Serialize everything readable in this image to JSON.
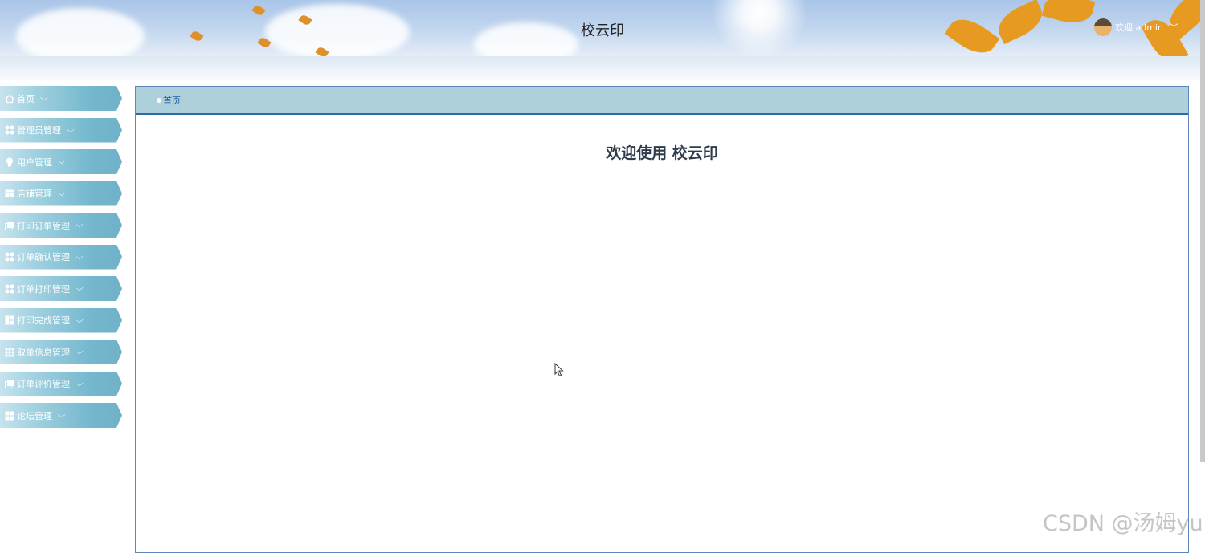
{
  "header": {
    "app_title": "校云印",
    "user_greeting": "欢迎 admin"
  },
  "sidebar": {
    "items": [
      {
        "label": "首页",
        "icon": "home-icon"
      },
      {
        "label": "管理员管理",
        "icon": "grid-circles-icon"
      },
      {
        "label": "用户管理",
        "icon": "user-icon"
      },
      {
        "label": "店铺管理",
        "icon": "shop-icon"
      },
      {
        "label": "打印订单管理",
        "icon": "copy-icon"
      },
      {
        "label": "订单确认管理",
        "icon": "grid-circles-icon"
      },
      {
        "label": "订单打印管理",
        "icon": "grid-circles-icon"
      },
      {
        "label": "打印完成管理",
        "icon": "layout-icon"
      },
      {
        "label": "取单信息管理",
        "icon": "apps-icon"
      },
      {
        "label": "订单评价管理",
        "icon": "copy-icon"
      },
      {
        "label": "论坛管理",
        "icon": "layout-icon"
      }
    ]
  },
  "main": {
    "breadcrumb": "首页",
    "welcome": "欢迎使用 校云印"
  },
  "watermark": "CSDN @汤姆yu",
  "colors": {
    "nav_accent": "#74b7cd",
    "breadcrumb_bg": "#aed0db",
    "border_blue": "#2d6aa6"
  }
}
